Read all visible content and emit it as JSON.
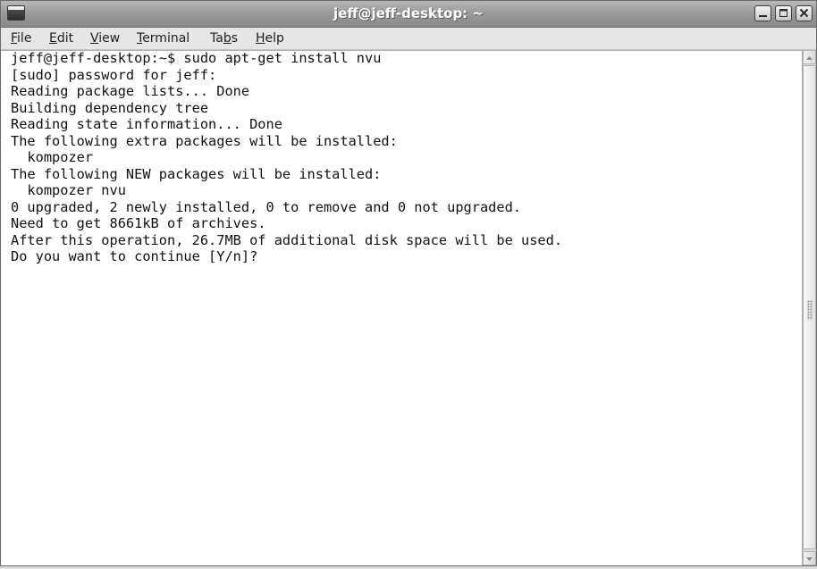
{
  "window": {
    "title": "jeff@jeff-desktop: ~"
  },
  "menu": [
    {
      "mnemonic": "F",
      "rest": "ile"
    },
    {
      "mnemonic": "E",
      "rest": "dit"
    },
    {
      "mnemonic": "V",
      "rest": "iew"
    },
    {
      "mnemonic": "T",
      "rest": "erminal"
    },
    {
      "pre": "Ta",
      "mnemonic": "b",
      "rest": "s"
    },
    {
      "mnemonic": "H",
      "rest": "elp"
    }
  ],
  "terminal": {
    "lines": [
      "jeff@jeff-desktop:~$ sudo apt-get install nvu",
      "[sudo] password for jeff:",
      "Reading package lists... Done",
      "Building dependency tree",
      "Reading state information... Done",
      "The following extra packages will be installed:",
      "  kompozer",
      "The following NEW packages will be installed:",
      "  kompozer nvu",
      "0 upgraded, 2 newly installed, 0 to remove and 0 not upgraded.",
      "Need to get 8661kB of archives.",
      "After this operation, 26.7MB of additional disk space will be used.",
      "Do you want to continue [Y/n]?"
    ]
  },
  "icons": {
    "app": "terminal-icon",
    "minimize": "minimize-icon",
    "maximize": "maximize-icon",
    "close": "close-icon",
    "scroll_up": "arrow-up-icon",
    "scroll_down": "arrow-down-icon"
  },
  "colors": {
    "titlebar": "#9a9a9a",
    "terminal_bg": "#ffffff",
    "terminal_fg": "#111111"
  }
}
